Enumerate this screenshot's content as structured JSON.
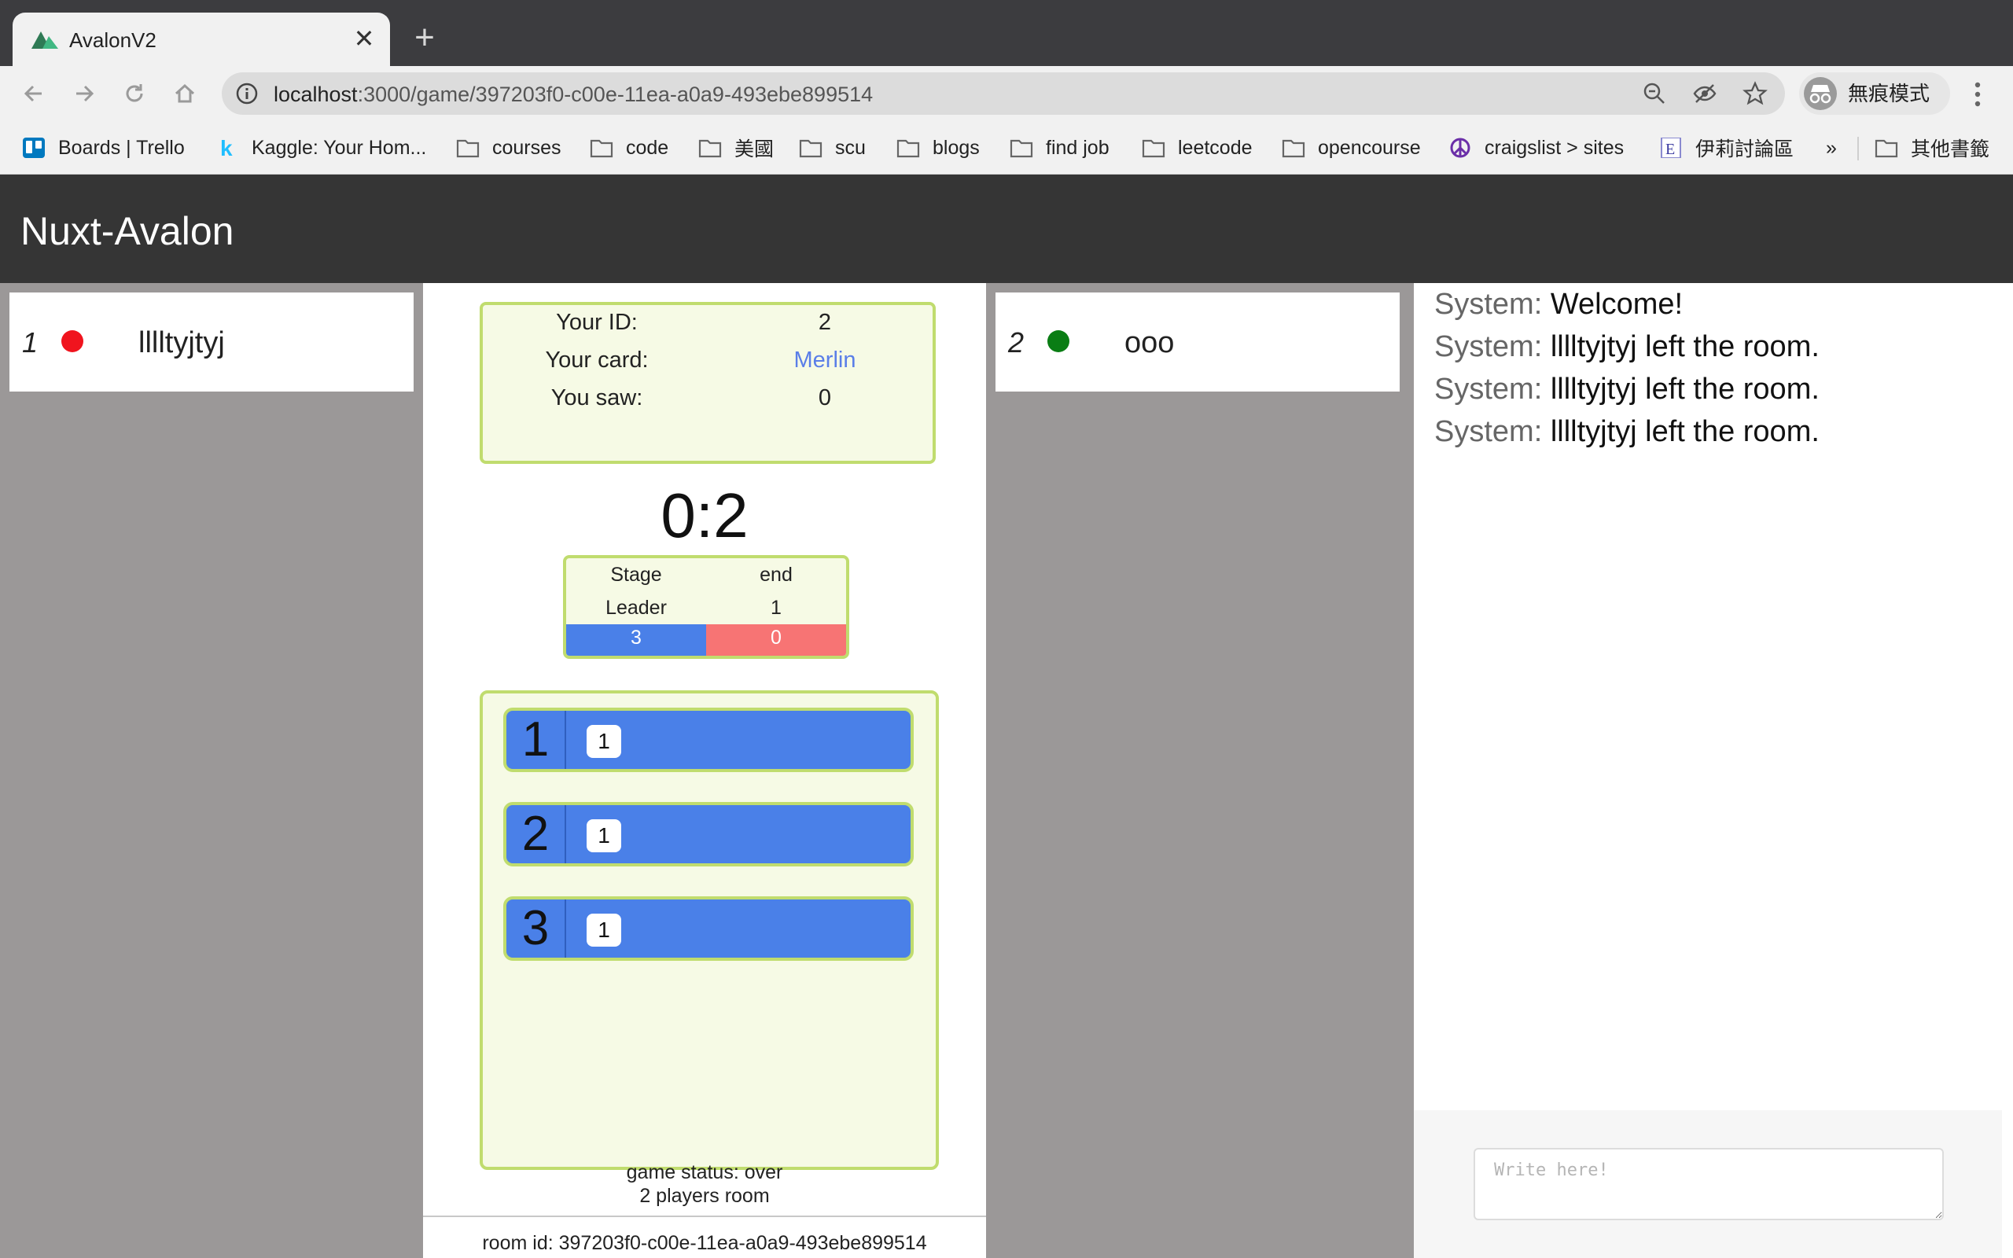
{
  "browser": {
    "tab_title": "AvalonV2",
    "tab_close": "✕",
    "new_tab": "+",
    "url_host": "localhost",
    "url_path": ":3000/game/397203f0-c00e-11ea-a0a9-493ebe899514",
    "profile_label": "無痕模式",
    "bookmarks": [
      {
        "label": "Boards | Trello",
        "icon": "trello-icon"
      },
      {
        "label": "Kaggle: Your Hom...",
        "icon": "kaggle-icon"
      },
      {
        "label": "courses",
        "icon": "folder-icon"
      },
      {
        "label": "code",
        "icon": "folder-icon"
      },
      {
        "label": "美國",
        "icon": "folder-icon"
      },
      {
        "label": "scu",
        "icon": "folder-icon"
      },
      {
        "label": "blogs",
        "icon": "folder-icon"
      },
      {
        "label": "find job",
        "icon": "folder-icon"
      },
      {
        "label": "leetcode",
        "icon": "folder-icon"
      },
      {
        "label": "opencourse",
        "icon": "folder-icon"
      },
      {
        "label": "craigslist > sites",
        "icon": "peace-icon"
      },
      {
        "label": "伊莉討論區",
        "icon": "eyny-icon"
      }
    ],
    "bookmarks_overflow": "»",
    "other_bookmarks": "其他書籤"
  },
  "app": {
    "title": "Nuxt-Avalon"
  },
  "players": [
    {
      "index": "1",
      "name": "lllltyjtyj",
      "status_color": "#f0141e"
    },
    {
      "index": "2",
      "name": "ooo",
      "status_color": "#0a7d14"
    }
  ],
  "info": {
    "id_label": "Your ID:",
    "id_value": "2",
    "card_label": "Your card:",
    "card_value": "Merlin",
    "saw_label": "You saw:",
    "saw_value": "0"
  },
  "score": "0:2",
  "stage": {
    "stage_label": "Stage",
    "stage_value": "end",
    "leader_label": "Leader",
    "leader_value": "1",
    "good_count": "3",
    "evil_count": "0"
  },
  "quests": [
    {
      "number": "1",
      "team_size": "1"
    },
    {
      "number": "2",
      "team_size": "1"
    },
    {
      "number": "3",
      "team_size": "1"
    }
  ],
  "game_status": "game status: over",
  "room_size": "2 players room",
  "room_id": "room id: 397203f0-c00e-11ea-a0a9-493ebe899514",
  "chat": {
    "messages": [
      {
        "sender": "System:",
        "text": "Welcome!"
      },
      {
        "sender": "System:",
        "text": "lllltyjtyj left the room."
      },
      {
        "sender": "System:",
        "text": "lllltyjtyj left the room."
      },
      {
        "sender": "System:",
        "text": "lllltyjtyj left the room."
      }
    ],
    "placeholder": "Write here!"
  },
  "colors": {
    "appbar": "#353535",
    "panel_bg": "#f6fae5",
    "panel_border": "#c0dc6e",
    "quest_blue": "#4a80e8",
    "evil_red": "#f77474"
  }
}
